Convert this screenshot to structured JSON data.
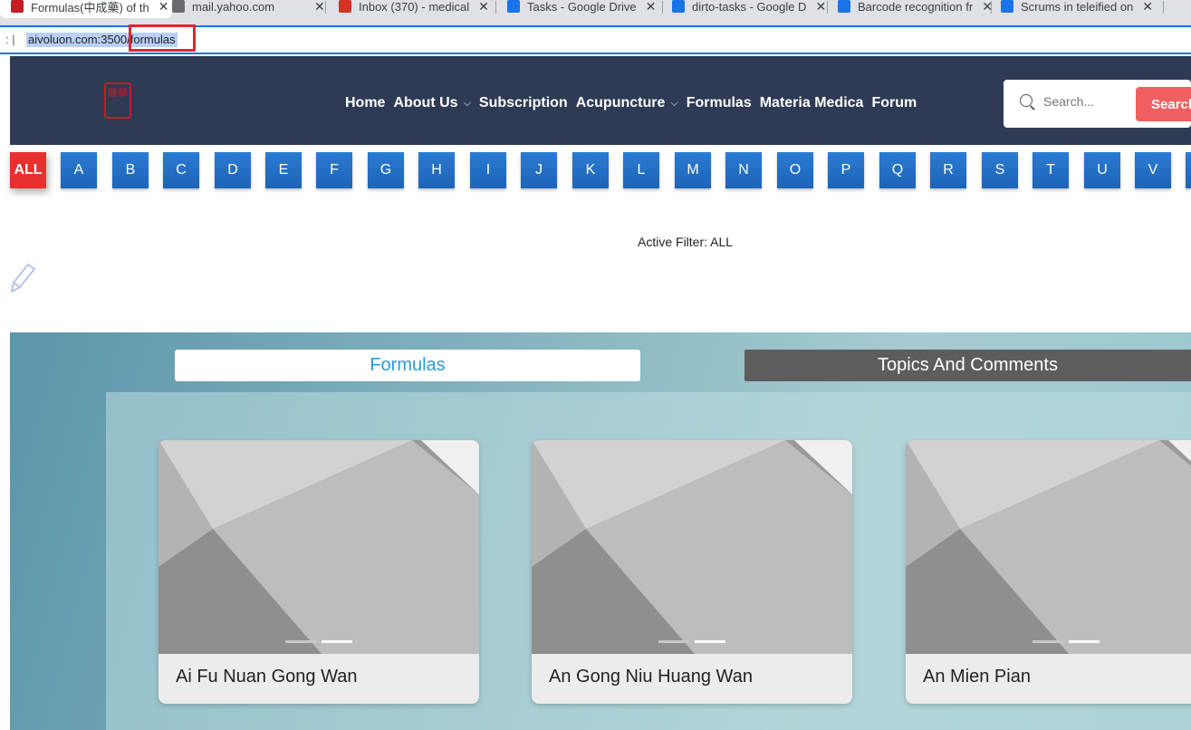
{
  "browser": {
    "tabs": [
      {
        "title": "Formulas(中成藥) of th",
        "favicon_color": "#c41e24",
        "active": true
      },
      {
        "title": "mail.yahoo.com",
        "favicon_color": "#6b6b6b",
        "active": false
      },
      {
        "title": "Inbox (370) - medical",
        "favicon_color": "#d93025",
        "active": false
      },
      {
        "title": "Tasks - Google Drive",
        "favicon_color": "#1a73e8",
        "active": false
      },
      {
        "title": "dirto-tasks - Google D",
        "favicon_color": "#1a73e8",
        "active": false
      },
      {
        "title": "Barcode recognition fr",
        "favicon_color": "#1a73e8",
        "active": false
      },
      {
        "title": "Scrums in teleified on",
        "favicon_color": "#1a73e8",
        "active": false
      }
    ],
    "url": "aivoluon.com:3500/formulas"
  },
  "header": {
    "logo_text": "醫學",
    "nav": [
      {
        "label": "Home",
        "dropdown": false
      },
      {
        "label": "About Us",
        "dropdown": true
      },
      {
        "label": "Subscription",
        "dropdown": false
      },
      {
        "label": "Acupuncture",
        "dropdown": true
      },
      {
        "label": "Formulas",
        "dropdown": false
      },
      {
        "label": "Materia Medica",
        "dropdown": false
      },
      {
        "label": "Forum",
        "dropdown": false
      }
    ],
    "search": {
      "placeholder": "Search...",
      "button_label": "Search"
    }
  },
  "filter": {
    "letters": [
      "ALL",
      "A",
      "B",
      "C",
      "D",
      "E",
      "F",
      "G",
      "H",
      "I",
      "J",
      "K",
      "L",
      "M",
      "N",
      "O",
      "P",
      "Q",
      "R",
      "S",
      "T",
      "U",
      "V"
    ],
    "active": "ALL",
    "active_text": "Active Filter: ALL"
  },
  "content": {
    "tabs": {
      "formulas": "Formulas",
      "topics": "Topics And Comments"
    },
    "cards": [
      {
        "title": "Ai Fu Nuan Gong Wan"
      },
      {
        "title": "An Gong Niu Huang Wan"
      },
      {
        "title": "An Mien Pian"
      }
    ]
  },
  "colors": {
    "header_bg": "#2f3a55",
    "letter_blue": "#1c64b8",
    "active_letter": "#e8302f",
    "search_button": "#f06060",
    "formulas_tab_text": "#2a9bdc",
    "topics_tab_bg": "#5d5d5d"
  }
}
